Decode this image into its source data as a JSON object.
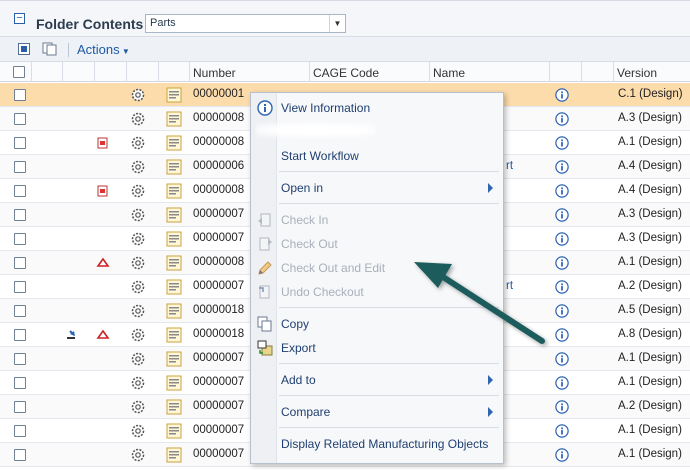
{
  "header": {
    "title": "Folder Contents",
    "folder_select": "Parts"
  },
  "toolbar": {
    "actions_label": "Actions"
  },
  "columns": {
    "number": "Number",
    "cage_code": "CAGE Code",
    "name": "Name",
    "version": "Version"
  },
  "rows": [
    {
      "number": "00000001",
      "version": "C.1 (Design)"
    },
    {
      "number": "00000008",
      "version": "A.3 (Design)"
    },
    {
      "number": "00000008",
      "version": "A.1 (Design)"
    },
    {
      "number": "00000006",
      "version": "A.4 (Design)",
      "name_fragment": "rt"
    },
    {
      "number": "00000008",
      "version": "A.4 (Design)"
    },
    {
      "number": "00000007",
      "version": "A.3 (Design)"
    },
    {
      "number": "00000007",
      "version": "A.3 (Design)"
    },
    {
      "number": "00000008",
      "version": "A.1 (Design)"
    },
    {
      "number": "00000007",
      "version": "A.2 (Design)",
      "name_fragment": "rt"
    },
    {
      "number": "00000018",
      "version": "A.5 (Design)"
    },
    {
      "number": "00000018",
      "version": "A.8 (Design)"
    },
    {
      "number": "00000007",
      "version": "A.1 (Design)"
    },
    {
      "number": "00000007",
      "version": "A.1 (Design)"
    },
    {
      "number": "00000007",
      "version": "A.2 (Design)"
    },
    {
      "number": "00000007",
      "version": "A.1 (Design)"
    },
    {
      "number": "00000007",
      "version": "A.1 (Design)"
    }
  ],
  "menu": {
    "view_information": "View Information",
    "start_workflow": "Start Workflow",
    "open_in": "Open in",
    "check_in": "Check In",
    "check_out": "Check Out",
    "check_out_edit": "Check Out and Edit",
    "undo_checkout": "Undo Checkout",
    "copy": "Copy",
    "export": "Export",
    "add_to": "Add to",
    "compare": "Compare",
    "display_related": "Display Related Manufacturing Objects"
  },
  "colors": {
    "selected_row": "#fcdcab",
    "link_blue": "#1d5aa6",
    "arrow_teal": "#1f5c5c"
  }
}
